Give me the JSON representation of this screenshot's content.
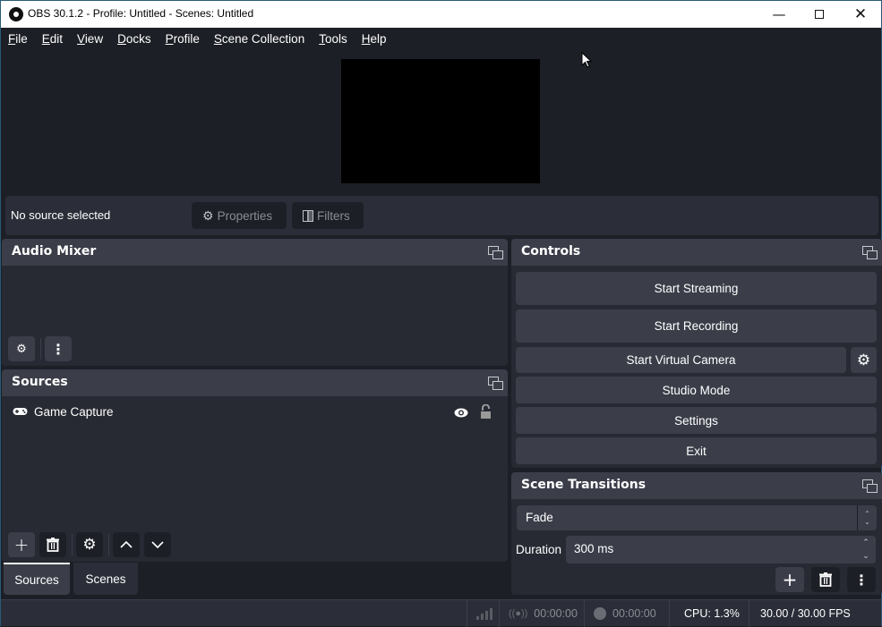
{
  "window": {
    "title": "OBS 30.1.2 - Profile: Untitled - Scenes: Untitled",
    "minimize_icon": "minimize-icon",
    "maximize_icon": "maximize-icon",
    "close_icon": "close-icon"
  },
  "menu": {
    "items": [
      {
        "label": "File",
        "mnemonic": "F"
      },
      {
        "label": "Edit",
        "mnemonic": "E"
      },
      {
        "label": "View",
        "mnemonic": "V"
      },
      {
        "label": "Docks",
        "mnemonic": "D"
      },
      {
        "label": "Profile",
        "mnemonic": "P"
      },
      {
        "label": "Scene Collection",
        "mnemonic": "S"
      },
      {
        "label": "Tools",
        "mnemonic": "T"
      },
      {
        "label": "Help",
        "mnemonic": "H"
      }
    ]
  },
  "context_bar": {
    "label": "No source selected",
    "properties_label": "Properties",
    "filters_label": "Filters"
  },
  "audio_mixer": {
    "title": "Audio Mixer"
  },
  "sources": {
    "title": "Sources",
    "items": [
      {
        "name": "Game Capture",
        "icon": "gamepad-icon",
        "visible": true,
        "locked": false
      }
    ]
  },
  "dock_tabs": [
    {
      "label": "Sources",
      "active": true
    },
    {
      "label": "Scenes",
      "active": false
    }
  ],
  "controls": {
    "title": "Controls",
    "start_streaming": "Start Streaming",
    "start_recording": "Start Recording",
    "start_virtual_camera": "Start Virtual Camera",
    "studio_mode": "Studio Mode",
    "settings": "Settings",
    "exit": "Exit"
  },
  "scene_transitions": {
    "title": "Scene Transitions",
    "transition": "Fade",
    "duration_label": "Duration",
    "duration_value": "300 ms"
  },
  "status_bar": {
    "stream_time": "00:00:00",
    "record_time": "00:00:00",
    "cpu": "CPU: 1.3%",
    "fps": "30.00 / 30.00 FPS"
  }
}
